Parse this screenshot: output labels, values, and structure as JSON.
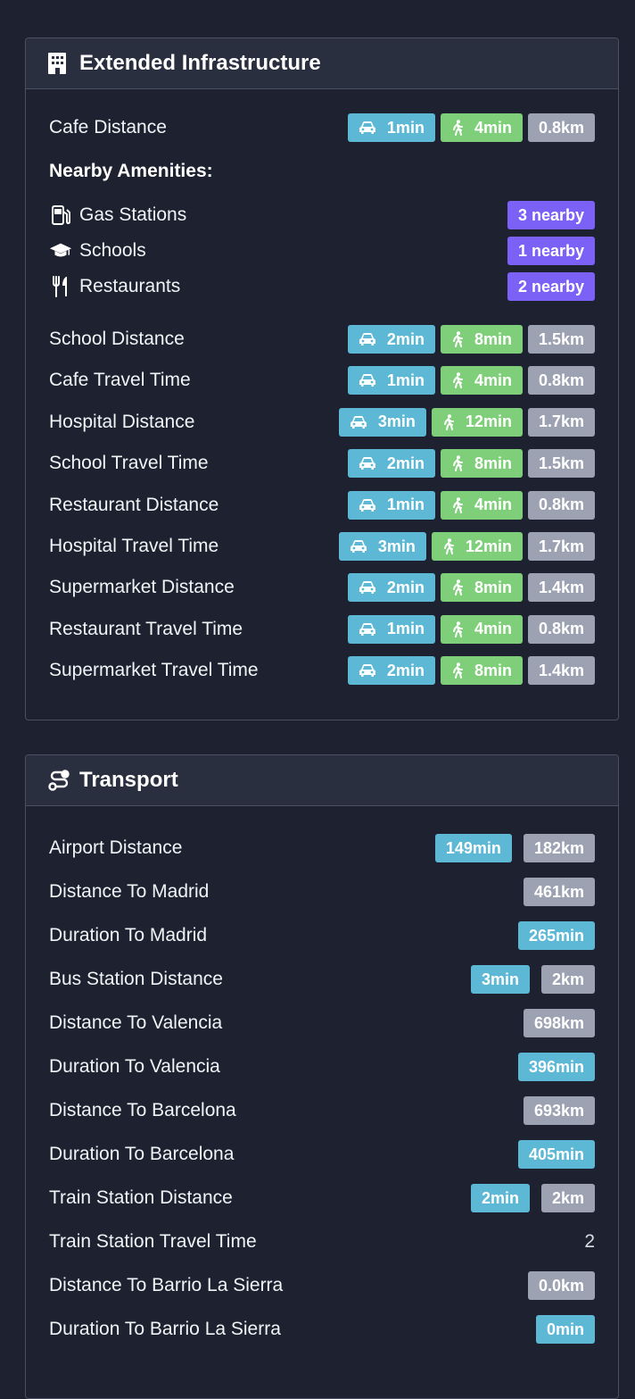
{
  "infrastructure": {
    "title": "Extended Infrastructure",
    "icon": "building-icon",
    "cafe_distance": {
      "label": "Cafe Distance",
      "car": "1min",
      "walk": "4min",
      "dist": "0.8km"
    },
    "amenities_heading": "Nearby Amenities:",
    "amenities": [
      {
        "label": "Gas Stations",
        "icon": "gas-pump-icon",
        "count": "3 nearby"
      },
      {
        "label": "Schools",
        "icon": "graduation-cap-icon",
        "count": "1 nearby"
      },
      {
        "label": "Restaurants",
        "icon": "utensils-icon",
        "count": "2 nearby"
      }
    ],
    "rows": [
      {
        "label": "School Distance",
        "car": "2min",
        "walk": "8min",
        "dist": "1.5km"
      },
      {
        "label": "Cafe Travel Time",
        "car": "1min",
        "walk": "4min",
        "dist": "0.8km"
      },
      {
        "label": "Hospital Distance",
        "car": "3min",
        "walk": "12min",
        "dist": "1.7km"
      },
      {
        "label": "School Travel Time",
        "car": "2min",
        "walk": "8min",
        "dist": "1.5km"
      },
      {
        "label": "Restaurant Distance",
        "car": "1min",
        "walk": "4min",
        "dist": "0.8km"
      },
      {
        "label": "Hospital Travel Time",
        "car": "3min",
        "walk": "12min",
        "dist": "1.7km"
      },
      {
        "label": "Supermarket Distance",
        "car": "2min",
        "walk": "8min",
        "dist": "1.4km"
      },
      {
        "label": "Restaurant Travel Time",
        "car": "1min",
        "walk": "4min",
        "dist": "0.8km"
      },
      {
        "label": "Supermarket Travel Time",
        "car": "2min",
        "walk": "8min",
        "dist": "1.4km"
      }
    ]
  },
  "transport": {
    "title": "Transport",
    "icon": "route-icon",
    "rows": [
      {
        "label": "Airport Distance",
        "time": "149min",
        "dist": "182km"
      },
      {
        "label": "Distance To Madrid",
        "dist": "461km"
      },
      {
        "label": "Duration To Madrid",
        "time": "265min"
      },
      {
        "label": "Bus Station Distance",
        "time": "3min",
        "dist": "2km"
      },
      {
        "label": "Distance To Valencia",
        "dist": "698km"
      },
      {
        "label": "Duration To Valencia",
        "time": "396min"
      },
      {
        "label": "Distance To Barcelona",
        "dist": "693km"
      },
      {
        "label": "Duration To Barcelona",
        "time": "405min"
      },
      {
        "label": "Train Station Distance",
        "time": "2min",
        "dist": "2km"
      },
      {
        "label": "Train Station Travel Time",
        "plain": "2"
      },
      {
        "label": "Distance To Barrio La Sierra",
        "dist": "0.0km"
      },
      {
        "label": "Duration To Barrio La Sierra",
        "time": "0min"
      }
    ]
  },
  "colors": {
    "car": "#5cb8d4",
    "walk": "#7fce7a",
    "distance": "#9da2b3",
    "nearby": "#7b61f5",
    "background": "#1e2230"
  }
}
